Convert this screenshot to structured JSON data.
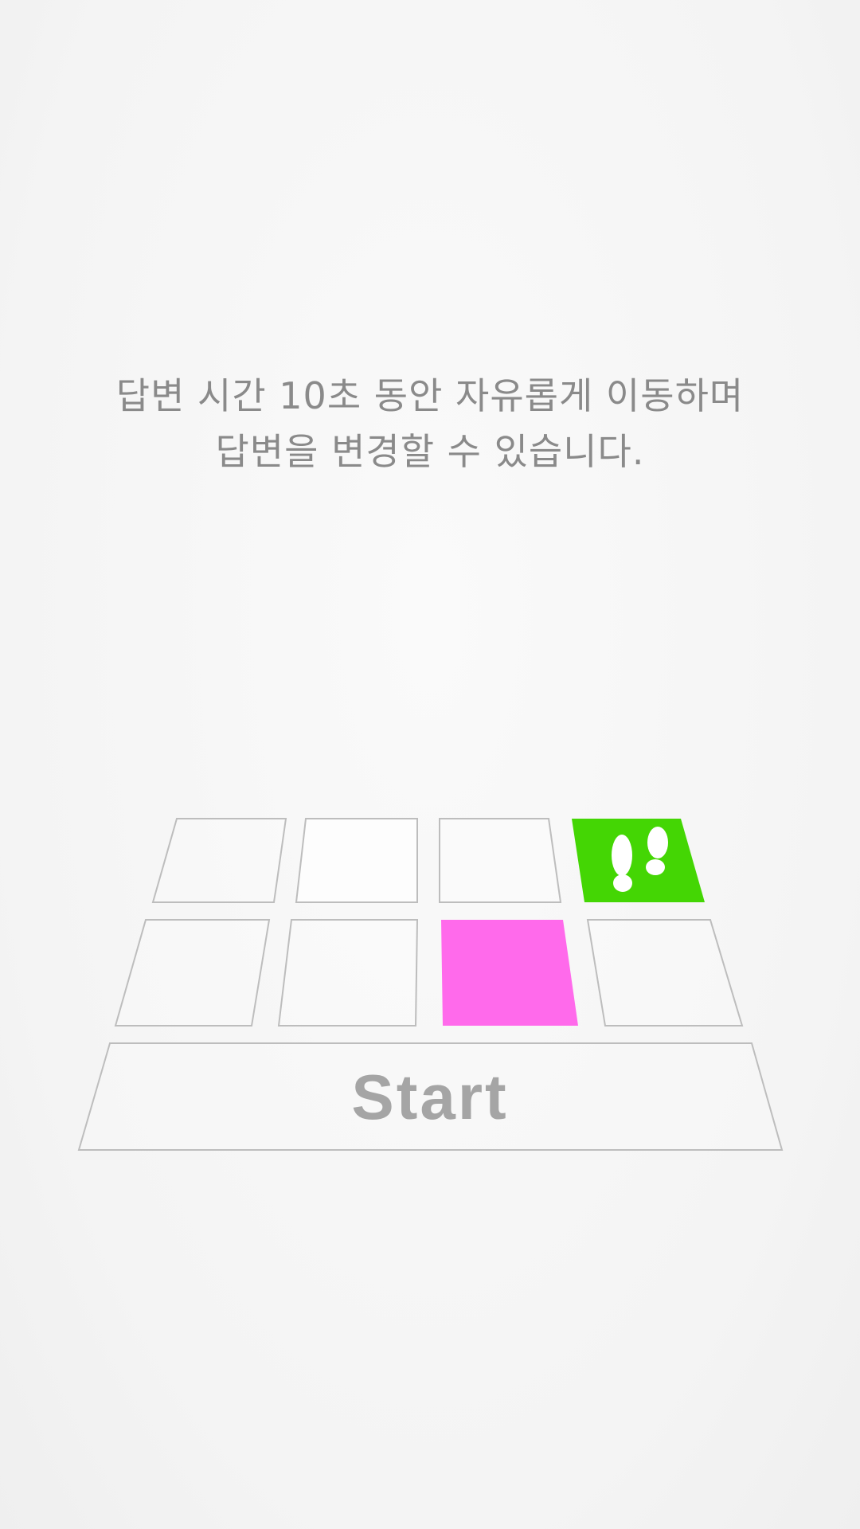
{
  "instruction": {
    "line1": "답변 시간 10초 동안 자유롭게 이동하며",
    "line2": "답변을 변경할 수 있습니다."
  },
  "board": {
    "start_label": "Start",
    "rows": [
      {
        "tiles": [
          {
            "state": "empty"
          },
          {
            "state": "empty"
          },
          {
            "state": "empty"
          },
          {
            "state": "player",
            "icon": "footprints-icon"
          }
        ]
      },
      {
        "tiles": [
          {
            "state": "empty"
          },
          {
            "state": "empty"
          },
          {
            "state": "selected"
          },
          {
            "state": "empty"
          }
        ]
      }
    ]
  },
  "colors": {
    "player_tile": "#44d604",
    "selected_tile": "#ff6aeb",
    "tile_outline": "#bdbdbd",
    "text": "#8a8a8a",
    "start_text": "#a5a5a5"
  }
}
